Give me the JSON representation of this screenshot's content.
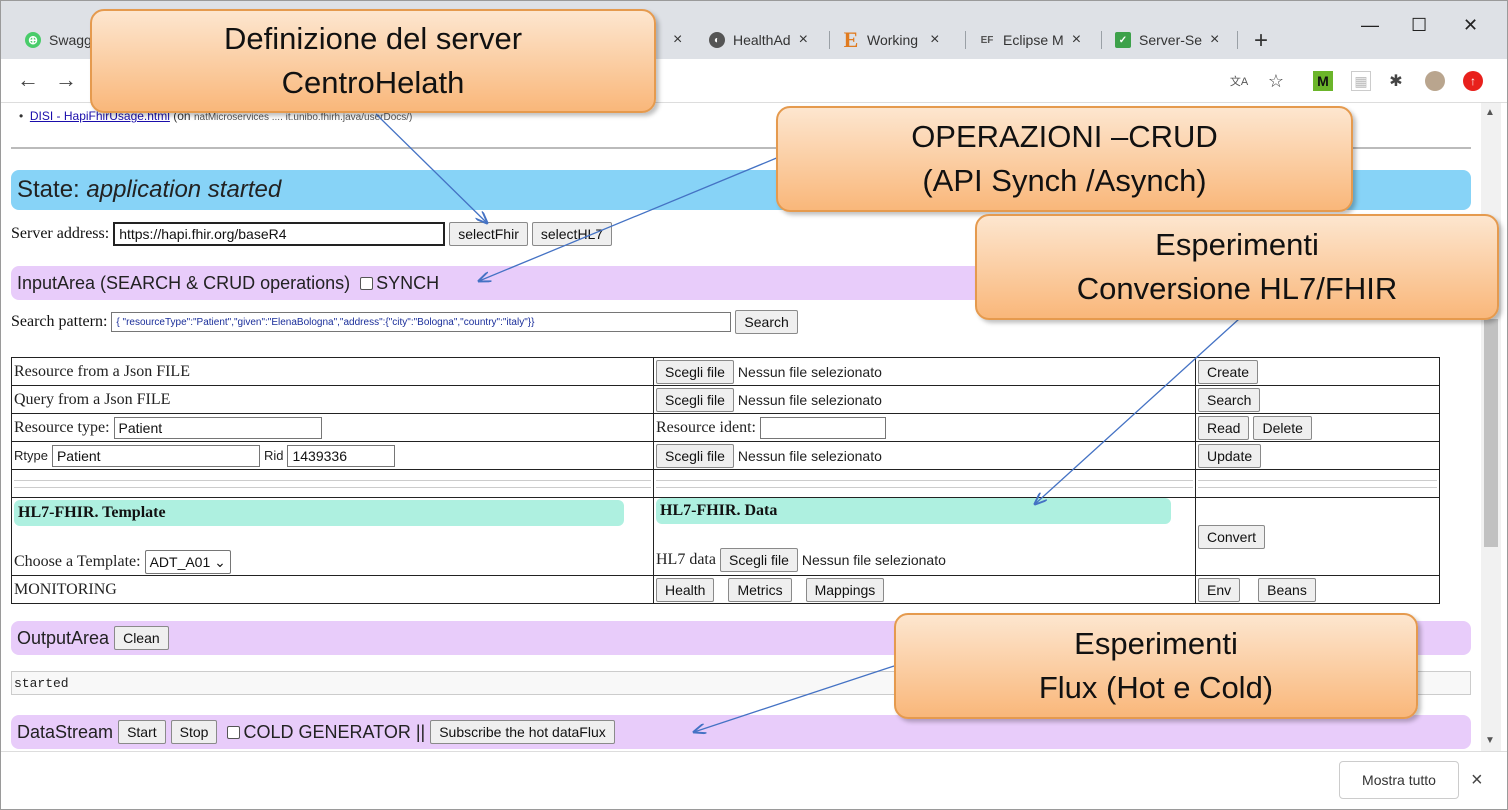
{
  "browser": {
    "tabs": [
      {
        "label": "Swagg",
        "icon": "swagger-icon"
      },
      {
        "label": "HealthAd",
        "icon": "globe-icon"
      },
      {
        "label": "Working",
        "icon": "e-icon"
      },
      {
        "label": "Eclipse M",
        "icon": "ef-icon"
      },
      {
        "label": "Server-Se",
        "icon": "spring-icon"
      }
    ],
    "close_glyph": "×",
    "new_tab_glyph": "+"
  },
  "page": {
    "bullet_link": "DISI - HapiFhirUsage.html",
    "bullet_rest": "(on",
    "bullet_small": "natMicroservices .... it.unibo.fhirh.java/userDocs/)",
    "state_label": "State:",
    "state_value": "application started",
    "server_label": "Server address:",
    "server_value": "https://hapi.fhir.org/baseR4",
    "btn_selectFhir": "selectFhir",
    "btn_selectHL7": "selectHL7",
    "input_area": "InputArea (SEARCH & CRUD operations)",
    "synch": "SYNCH",
    "search_label": "Search pattern:",
    "search_value": "{ \"resourceType\":\"Patient\",\"given\":\"ElenaBologna\",\"address\":{\"city\":\"Bologna\",\"country\":\"italy\"}}",
    "btn_search": "Search",
    "choose_file": "Scegli file",
    "no_file": "Nessun file selezionato",
    "row1": "Resource from a Json FILE",
    "row2": "Query from a Json FILE",
    "row3_label": "Resource type:",
    "row3_value": "Patient",
    "resource_ident": "Resource ident:",
    "rtype_label": "Rtype",
    "rtype_value": "Patient",
    "rid_label": "Rid",
    "rid_value": "1439336",
    "btn_create": "Create",
    "btn_search2": "Search",
    "btn_read": "Read",
    "btn_delete": "Delete",
    "btn_update": "Update",
    "hl7_template": "HL7-FHIR. Template",
    "hl7_data": "HL7-FHIR. Data",
    "choose_template": "Choose a Template:",
    "template_value": "ADT_A01",
    "hl7_data_label": "HL7 data",
    "btn_convert": "Convert",
    "monitoring": "MONITORING",
    "btn_health": "Health",
    "btn_metrics": "Metrics",
    "btn_mappings": "Mappings",
    "btn_env": "Env",
    "btn_beans": "Beans",
    "output_area": "OutputArea",
    "btn_clean": "Clean",
    "output_text": "started",
    "datastream": "DataStream",
    "btn_start": "Start",
    "btn_stop": "Stop",
    "cold": "COLD GENERATOR ||",
    "btn_subscribe": "Subscribe the hot dataFlux"
  },
  "download_bar": {
    "show_all": "Mostra tutto",
    "close": "×"
  },
  "callouts": {
    "c1_line1": "Definizione del server",
    "c1_line2": "CentroHelath",
    "c2_line1": "OPERAZIONI –CRUD",
    "c2_line2": "(API  Synch /Asynch)",
    "c3_line1": "Esperimenti",
    "c3_line2": "Conversione HL7/FHIR",
    "c4_line1": "Esperimenti",
    "c4_line2": "Flux (Hot e Cold)"
  },
  "colors": {
    "state_bar": "#87d3f7",
    "purple_bar": "#e8ccfa",
    "teal_bar": "#aef0e0",
    "callout": "#f9b77a"
  }
}
